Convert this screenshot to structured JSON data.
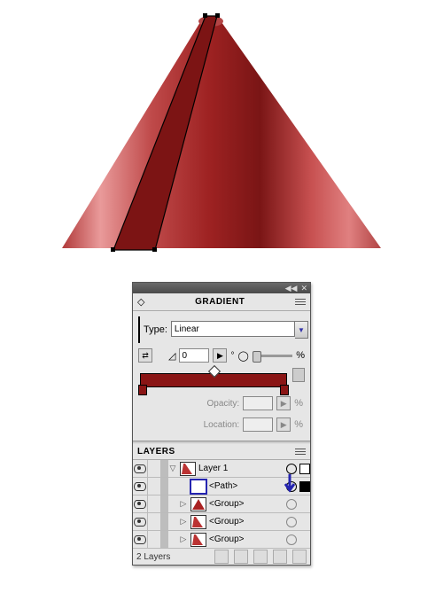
{
  "panels": {
    "gradient": {
      "title": "GRADIENT",
      "type_label": "Type:",
      "type_value": "Linear",
      "angle_value": "0",
      "angle_unit": "°",
      "length_pct": "",
      "opacity_label": "Opacity:",
      "opacity_value": "",
      "location_label": "Location:",
      "location_value": "",
      "pct_symbol": "%",
      "stops": [
        "#8a1515",
        "#8a1515"
      ]
    },
    "layers": {
      "title": "LAYERS",
      "footer_count": "2 Layers",
      "items": [
        {
          "name": "Layer 1",
          "twist": "▽",
          "color": "#bdbdbd",
          "thumb": "stripe",
          "target": "sel",
          "selbox": "blank"
        },
        {
          "name": "<Path>",
          "twist": "",
          "color": "#bdbdbd",
          "thumb": "stripe",
          "target": "sel",
          "selbox": "fill",
          "selected": true
        },
        {
          "name": "<Group>",
          "twist": "▷",
          "color": "#bdbdbd",
          "thumb": "cone",
          "target": "",
          "selbox": ""
        },
        {
          "name": "<Group>",
          "twist": "▷",
          "color": "#bdbdbd",
          "thumb": "stripe",
          "target": "",
          "selbox": ""
        },
        {
          "name": "<Group>",
          "twist": "▷",
          "color": "#bdbdbd",
          "thumb": "stripe",
          "target": "",
          "selbox": ""
        }
      ]
    },
    "icons": {
      "collapse": "◀◀",
      "close": "✕",
      "play": "▶",
      "diamond": "◇"
    }
  },
  "artwork": {
    "description": "red cone with dark red stripe path selected"
  }
}
